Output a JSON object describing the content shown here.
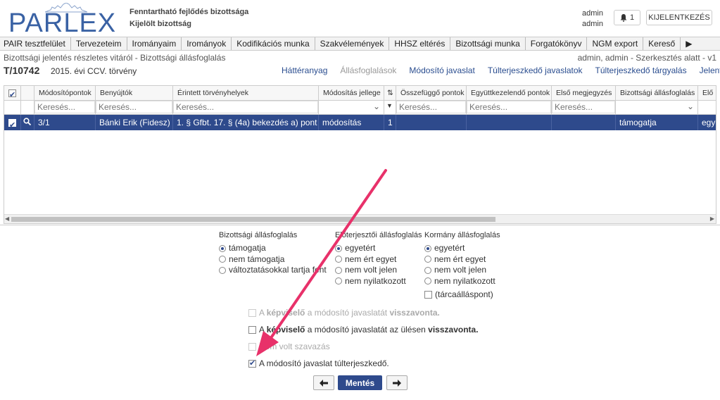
{
  "header": {
    "logo_text": "PARLEX",
    "org_line1": "Fenntartható fejlődés bizottsága",
    "org_line2": "Kijelölt bizottság",
    "user_line1": "admin",
    "user_line2": "admin",
    "notification_count": "1",
    "logout_label": "KIJELENTKEZÉS"
  },
  "menu": [
    "PAIR tesztfelület",
    "Tervezeteim",
    "Irományaim",
    "Irományok",
    "Kodifikációs munka",
    "Szakvélemények",
    "HHSZ eltérés",
    "Bizottsági munka",
    "Forgatókönyv",
    "NGM export",
    "Kereső",
    "▶"
  ],
  "doc": {
    "breadcrumb": "Bizottsági jelentés részletes vitáról - Bizottsági állásfoglalás",
    "status": "admin, admin - Szerkesztés alatt - v1",
    "id": "T/10742",
    "title": "2015. évi CCV. törvény",
    "tabs": [
      "Háttéranyag",
      "Állásfoglalások",
      "Módosító javaslat",
      "Túlterjeszkedő javaslatok",
      "Túlterjeszkedő tárgyalás",
      "Jelentés"
    ]
  },
  "grid": {
    "columns": [
      "",
      "",
      "Módosítópontok",
      "Benyújtók",
      "Érintett törvényhelyek",
      "Módosítás jellege",
      "⇅",
      "Összefüggő pontok",
      "Együttkezelendő pontok",
      "Első megjegyzés",
      "Bizottsági állásfoglalás",
      "Elő"
    ],
    "filter_placeholder": "Keresés...",
    "row": {
      "modositopont": "3/1",
      "benyujto": "Bánki Erik (Fidesz)",
      "torvenyhely": "1. § Gfbt. 17. § (4a) bekezdés a) pont",
      "jelleg": "módosítás",
      "sorrend": "1",
      "osszefuggo": "",
      "egyuttkezelendo": "",
      "megjegyzes": "",
      "allasfoglalas": "támogatja",
      "elo": "egy"
    }
  },
  "panel": {
    "committee": {
      "title": "Bizottsági állásfoglalás",
      "options": [
        "támogatja",
        "nem támogatja",
        "változtatásokkal tartja fent"
      ],
      "selected": 0
    },
    "proposer": {
      "title": "Előterjesztői állásfoglalás",
      "options": [
        "egyetért",
        "nem ért egyet",
        "nem volt jelen",
        "nem nyilatkozott"
      ],
      "selected": 0
    },
    "government": {
      "title": "Kormány állásfoglalás",
      "options": [
        "egyetért",
        "nem ért egyet",
        "nem volt jelen",
        "nem nyilatkozott"
      ],
      "selected": 0,
      "extra_checkbox": "(tárcaálláspont)"
    },
    "checks": {
      "c1": {
        "pre": "A ",
        "bold": "képviselő",
        "mid": " a módosító javaslatát ",
        "bold2": "visszavonta."
      },
      "c2": {
        "pre": "A ",
        "bold": "képviselő",
        "mid": " a módosító javaslatát az ülésen ",
        "bold2": "visszavonta."
      },
      "c3": {
        "text": "Nem volt szavazás"
      },
      "c4": {
        "text": "A módosító javaslat túlterjeszkedő."
      }
    },
    "save_label": "Mentés",
    "prev_label": "🡐",
    "next_label": "🡒"
  },
  "colors": {
    "brand": "#3a62a4",
    "selected_row": "#2e4a8c",
    "annotation_arrow": "#e8316a"
  }
}
